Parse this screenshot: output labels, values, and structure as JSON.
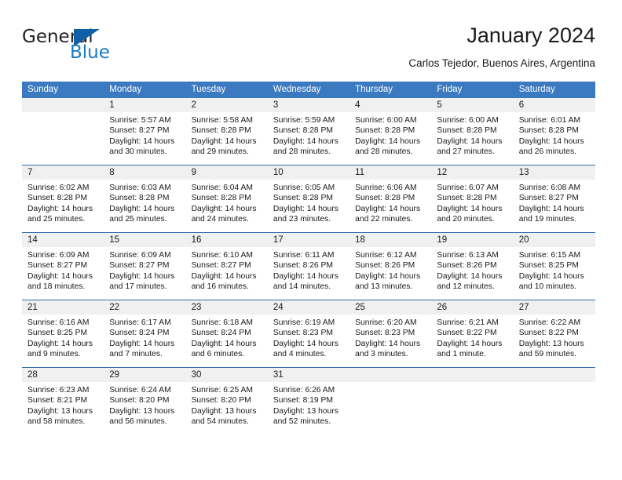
{
  "brand": {
    "name_part1": "General",
    "name_part2": "Blue",
    "accent_color": "#1a7ac4",
    "triangle_color": "#1060a8"
  },
  "header": {
    "title": "January 2024",
    "subtitle": "Carlos Tejedor, Buenos Aires, Argentina"
  },
  "calendar": {
    "header_bg": "#3b7ac0",
    "daterow_bg": "#f0f0f0",
    "week_divider_color": "#2f6cab",
    "day_names": [
      "Sunday",
      "Monday",
      "Tuesday",
      "Wednesday",
      "Thursday",
      "Friday",
      "Saturday"
    ],
    "weeks": [
      {
        "days": [
          {
            "num": "",
            "text": ""
          },
          {
            "num": "1",
            "text": "Sunrise: 5:57 AM\nSunset: 8:27 PM\nDaylight: 14 hours\nand 30 minutes."
          },
          {
            "num": "2",
            "text": "Sunrise: 5:58 AM\nSunset: 8:28 PM\nDaylight: 14 hours\nand 29 minutes."
          },
          {
            "num": "3",
            "text": "Sunrise: 5:59 AM\nSunset: 8:28 PM\nDaylight: 14 hours\nand 28 minutes."
          },
          {
            "num": "4",
            "text": "Sunrise: 6:00 AM\nSunset: 8:28 PM\nDaylight: 14 hours\nand 28 minutes."
          },
          {
            "num": "5",
            "text": "Sunrise: 6:00 AM\nSunset: 8:28 PM\nDaylight: 14 hours\nand 27 minutes."
          },
          {
            "num": "6",
            "text": "Sunrise: 6:01 AM\nSunset: 8:28 PM\nDaylight: 14 hours\nand 26 minutes."
          }
        ]
      },
      {
        "days": [
          {
            "num": "7",
            "text": "Sunrise: 6:02 AM\nSunset: 8:28 PM\nDaylight: 14 hours\nand 25 minutes."
          },
          {
            "num": "8",
            "text": "Sunrise: 6:03 AM\nSunset: 8:28 PM\nDaylight: 14 hours\nand 25 minutes."
          },
          {
            "num": "9",
            "text": "Sunrise: 6:04 AM\nSunset: 8:28 PM\nDaylight: 14 hours\nand 24 minutes."
          },
          {
            "num": "10",
            "text": "Sunrise: 6:05 AM\nSunset: 8:28 PM\nDaylight: 14 hours\nand 23 minutes."
          },
          {
            "num": "11",
            "text": "Sunrise: 6:06 AM\nSunset: 8:28 PM\nDaylight: 14 hours\nand 22 minutes."
          },
          {
            "num": "12",
            "text": "Sunrise: 6:07 AM\nSunset: 8:28 PM\nDaylight: 14 hours\nand 20 minutes."
          },
          {
            "num": "13",
            "text": "Sunrise: 6:08 AM\nSunset: 8:27 PM\nDaylight: 14 hours\nand 19 minutes."
          }
        ]
      },
      {
        "days": [
          {
            "num": "14",
            "text": "Sunrise: 6:09 AM\nSunset: 8:27 PM\nDaylight: 14 hours\nand 18 minutes."
          },
          {
            "num": "15",
            "text": "Sunrise: 6:09 AM\nSunset: 8:27 PM\nDaylight: 14 hours\nand 17 minutes."
          },
          {
            "num": "16",
            "text": "Sunrise: 6:10 AM\nSunset: 8:27 PM\nDaylight: 14 hours\nand 16 minutes."
          },
          {
            "num": "17",
            "text": "Sunrise: 6:11 AM\nSunset: 8:26 PM\nDaylight: 14 hours\nand 14 minutes."
          },
          {
            "num": "18",
            "text": "Sunrise: 6:12 AM\nSunset: 8:26 PM\nDaylight: 14 hours\nand 13 minutes."
          },
          {
            "num": "19",
            "text": "Sunrise: 6:13 AM\nSunset: 8:26 PM\nDaylight: 14 hours\nand 12 minutes."
          },
          {
            "num": "20",
            "text": "Sunrise: 6:15 AM\nSunset: 8:25 PM\nDaylight: 14 hours\nand 10 minutes."
          }
        ]
      },
      {
        "days": [
          {
            "num": "21",
            "text": "Sunrise: 6:16 AM\nSunset: 8:25 PM\nDaylight: 14 hours\nand 9 minutes."
          },
          {
            "num": "22",
            "text": "Sunrise: 6:17 AM\nSunset: 8:24 PM\nDaylight: 14 hours\nand 7 minutes."
          },
          {
            "num": "23",
            "text": "Sunrise: 6:18 AM\nSunset: 8:24 PM\nDaylight: 14 hours\nand 6 minutes."
          },
          {
            "num": "24",
            "text": "Sunrise: 6:19 AM\nSunset: 8:23 PM\nDaylight: 14 hours\nand 4 minutes."
          },
          {
            "num": "25",
            "text": "Sunrise: 6:20 AM\nSunset: 8:23 PM\nDaylight: 14 hours\nand 3 minutes."
          },
          {
            "num": "26",
            "text": "Sunrise: 6:21 AM\nSunset: 8:22 PM\nDaylight: 14 hours\nand 1 minute."
          },
          {
            "num": "27",
            "text": "Sunrise: 6:22 AM\nSunset: 8:22 PM\nDaylight: 13 hours\nand 59 minutes."
          }
        ]
      },
      {
        "days": [
          {
            "num": "28",
            "text": "Sunrise: 6:23 AM\nSunset: 8:21 PM\nDaylight: 13 hours\nand 58 minutes."
          },
          {
            "num": "29",
            "text": "Sunrise: 6:24 AM\nSunset: 8:20 PM\nDaylight: 13 hours\nand 56 minutes."
          },
          {
            "num": "30",
            "text": "Sunrise: 6:25 AM\nSunset: 8:20 PM\nDaylight: 13 hours\nand 54 minutes."
          },
          {
            "num": "31",
            "text": "Sunrise: 6:26 AM\nSunset: 8:19 PM\nDaylight: 13 hours\nand 52 minutes."
          },
          {
            "num": "",
            "text": ""
          },
          {
            "num": "",
            "text": ""
          },
          {
            "num": "",
            "text": ""
          }
        ]
      }
    ]
  }
}
